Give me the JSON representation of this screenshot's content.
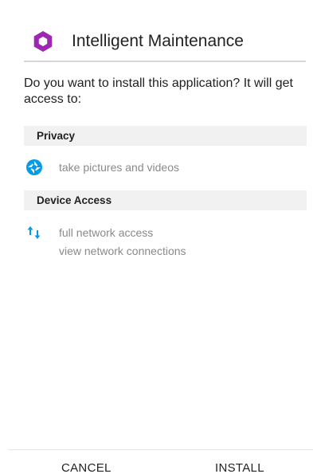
{
  "app": {
    "title": "Intelligent Maintenance",
    "icon": "hexagon-app-icon",
    "accent_color": "#9c27b0"
  },
  "prompt": {
    "text": "Do you want to install this application? It will get access to:"
  },
  "sections": [
    {
      "header": "Privacy",
      "permissions": [
        {
          "icon": "camera-shutter-icon",
          "icon_color": "#039be5",
          "lines": [
            "take pictures and videos"
          ]
        }
      ]
    },
    {
      "header": "Device Access",
      "permissions": [
        {
          "icon": "network-arrows-icon",
          "icon_color": "#039be5",
          "lines": [
            "full network access",
            "view network connections"
          ]
        }
      ]
    }
  ],
  "buttons": {
    "cancel": "CANCEL",
    "install": "INSTALL"
  }
}
